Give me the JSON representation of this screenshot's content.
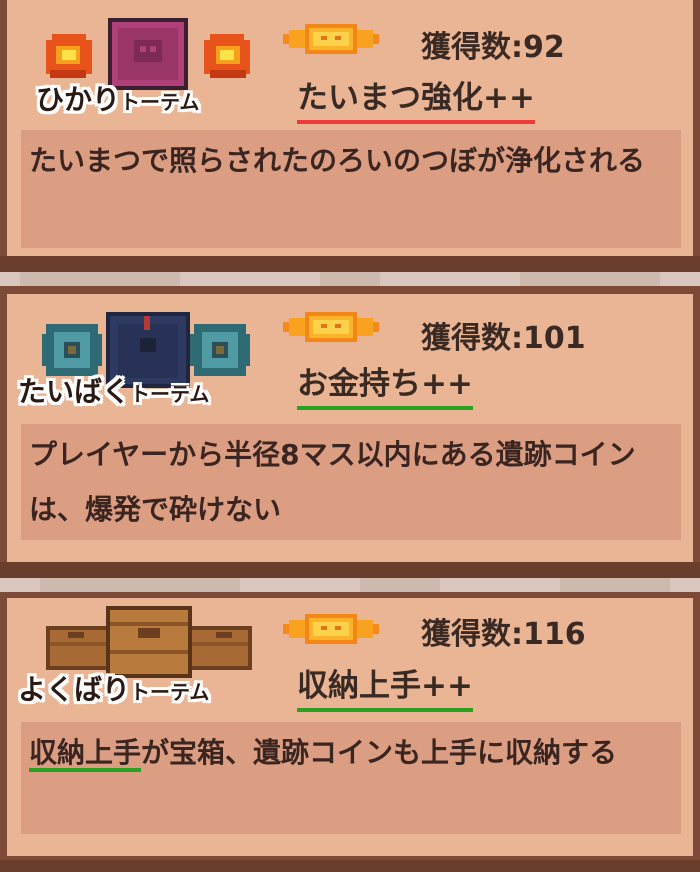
{
  "cards": [
    {
      "totem_name_main": "ひかり",
      "totem_name_suffix": "トーテム",
      "totem_icon": "light-totem-icon",
      "count_label": "獲得数:92",
      "upgrade_name": "たいまつ強化++",
      "underline_color": "#ee3a3a",
      "description": "たいまつで照らされたのろいのつぼが浄化される"
    },
    {
      "totem_name_main": "たいばく",
      "totem_name_suffix": "トーテム",
      "totem_icon": "blast-resist-totem-icon",
      "count_label": "獲得数:101",
      "upgrade_name": "お金持ち++",
      "underline_color": "#2aa121",
      "description": "プレイヤーから半径8マス以内にある遺跡コインは、爆発で砕けない"
    },
    {
      "totem_name_main": "よくばり",
      "totem_name_suffix": "トーテム",
      "totem_icon": "greed-totem-icon",
      "count_label": "獲得数:116",
      "upgrade_name": "収納上手++",
      "underline_color": "#2aa121",
      "description_highlight": "収納上手",
      "description_rest": "が宝箱、遺跡コインも上手に収納する"
    }
  ]
}
